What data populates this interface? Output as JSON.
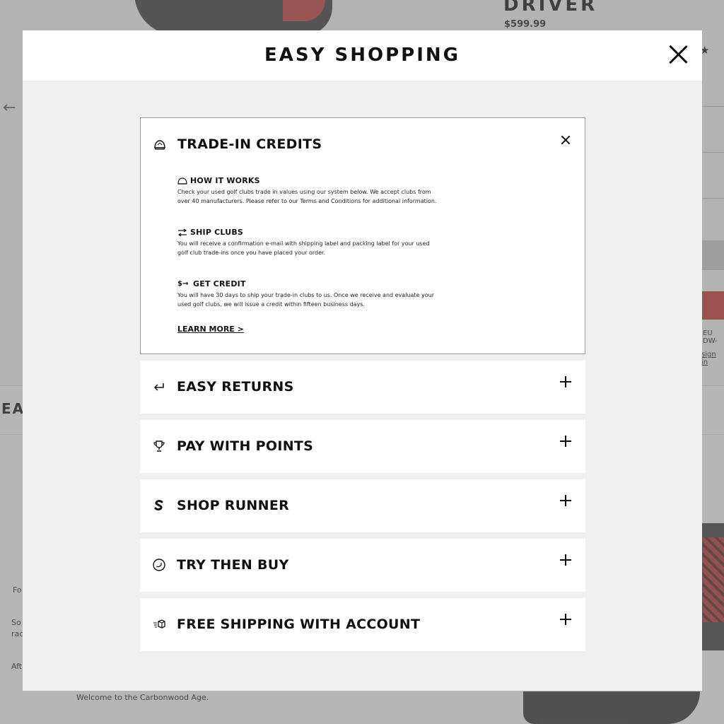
{
  "background": {
    "product_title": "DRIVER",
    "product_price": "$599.99",
    "stars": "★",
    "side_fragment_1": "EU DW-",
    "side_fragment_2": "sign in",
    "left_heading_fragment": "EA",
    "left_text_1": "Fo",
    "left_text_2": "So",
    "left_text_3": "rac",
    "left_text_4": "Aft",
    "welcome": "Welcome to the Carbonwood Age."
  },
  "modal": {
    "title": "EASY SHOPPING",
    "open_panel": {
      "title": "TRADE-IN CREDITS",
      "icon": "trade-in-helmet-icon",
      "steps": [
        {
          "icon": "how-it-works-icon",
          "heading": "HOW IT WORKS",
          "body": "Check your used golf clubs trade in values using our system below. We accept clubs from over 40 manufacturers. Please refer to our Terms and Conditions for additional information."
        },
        {
          "icon": "ship-clubs-icon",
          "heading": "SHIP CLUBS",
          "body": "You will receive a confirmation e-mail with shipping label and packing label for your used golf club trade-ins once you have placed your order."
        },
        {
          "icon": "get-credit-icon",
          "heading": "GET CREDIT",
          "body": "You will have 30 days to ship your trade-in clubs to us. Once we receive and evaluate your used golf clubs, we will issue a credit within fifteen business days."
        }
      ],
      "learn_more": "LEARN MORE >"
    },
    "rows": [
      {
        "title": "EASY RETURNS",
        "icon": "return-arrow-icon"
      },
      {
        "title": "PAY WITH POINTS",
        "icon": "trophy-icon"
      },
      {
        "title": "SHOP RUNNER",
        "icon": "shoprunner-icon"
      },
      {
        "title": "TRY THEN BUY",
        "icon": "try-then-buy-icon"
      },
      {
        "title": "FREE SHIPPING WITH ACCOUNT",
        "icon": "fast-shipping-box-icon"
      }
    ]
  }
}
